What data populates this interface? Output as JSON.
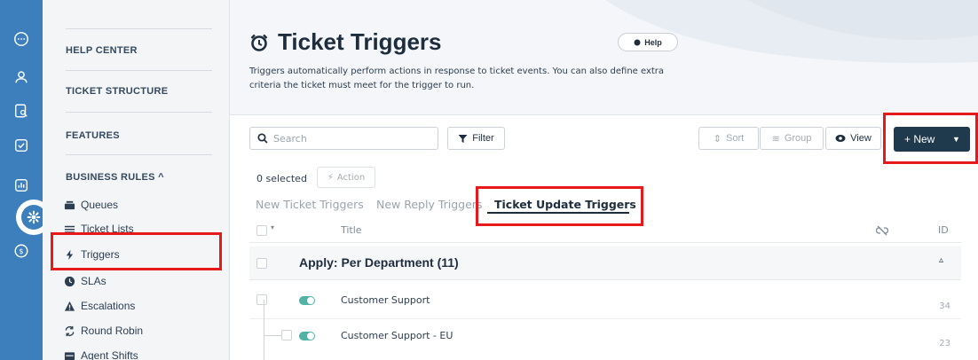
{
  "rail": {
    "icons": [
      "chat-icon",
      "user-icon",
      "search-doc-icon",
      "check-square-icon",
      "chart-icon",
      "gear-icon",
      "dollar-icon"
    ],
    "active": "gear-icon"
  },
  "nav": {
    "sections": [
      {
        "label": "HELP CENTER"
      },
      {
        "label": "TICKET STRUCTURE"
      },
      {
        "label": "FEATURES"
      },
      {
        "label": "BUSINESS RULES ^"
      }
    ],
    "items": [
      {
        "label": "Queues",
        "icon": "inbox-icon"
      },
      {
        "label": "Ticket Lists",
        "icon": "list-icon"
      },
      {
        "label": "Triggers",
        "icon": "bolt-icon"
      },
      {
        "label": "SLAs",
        "icon": "clock-icon"
      },
      {
        "label": "Escalations",
        "icon": "warning-icon"
      },
      {
        "label": "Round Robin",
        "icon": "cycle-icon"
      },
      {
        "label": "Agent Shifts",
        "icon": "calendar-icon"
      }
    ]
  },
  "header": {
    "title": "Ticket Triggers",
    "help_label": "Help",
    "description": "Triggers automatically perform actions in response to ticket events. You can also define extra criteria the ticket must meet for the trigger to run."
  },
  "toolbar": {
    "search_placeholder": "Search",
    "filter_label": "Filter",
    "sort_label": "Sort",
    "group_label": "Group",
    "view_label": "View",
    "new_label": "+ New"
  },
  "selection": {
    "count_text": "0 selected",
    "action_label": "Action"
  },
  "tabs": [
    {
      "label": "New Ticket Triggers",
      "active": false
    },
    {
      "label": "New Reply Triggers",
      "active": false
    },
    {
      "label": "Ticket Update Triggers",
      "active": true
    }
  ],
  "table": {
    "col_title": "Title",
    "col_id": "ID",
    "group": {
      "title": "Apply: Per Department (11)"
    },
    "rows": [
      {
        "title": "Customer Support",
        "id": "34",
        "enabled": true
      },
      {
        "title": "Customer Support - EU",
        "id": "23",
        "enabled": true
      }
    ]
  },
  "colors": {
    "rail": "#3d7fbd",
    "primary_button": "#1f3a4d",
    "toggle_on": "#4fb3a6",
    "annotation_red": "#e8191b"
  }
}
